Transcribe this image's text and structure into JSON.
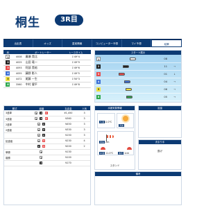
{
  "header": {
    "title": "桐生",
    "race_badge": "3R目"
  },
  "tabs": [
    {
      "label": "出走表"
    },
    {
      "label": "オッズ"
    },
    {
      "label": "直前情報"
    },
    {
      "label": "コンピューター予想"
    },
    {
      "label": "マイ予想"
    },
    {
      "label": "結果"
    }
  ],
  "racers": {
    "headers": [
      "枠",
      "",
      "ボートレーサー",
      "",
      "レースタイム"
    ],
    "rows": [
      {
        "lane": "1",
        "no": "4008",
        "name": "廣瀬 貴比",
        "time": "1'49\"4"
      },
      {
        "lane": "2",
        "no": "4025",
        "name": "山田 竜一",
        "time": "1'49\"9"
      },
      {
        "lane": "3",
        "no": "4093",
        "name": "阿部 貴裕",
        "time": "1'49\"6"
      },
      {
        "lane": "4",
        "no": "4055",
        "name": "藤野 影人",
        "time": "1'49\"5"
      },
      {
        "lane": "5",
        "no": "4472",
        "name": "尾藤 一生",
        "time": "1'50\"3"
      },
      {
        "lane": "6",
        "no": "3560",
        "name": "中村 健平",
        "time": "1'49\"8"
      }
    ]
  },
  "start": {
    "title": "スタート展示",
    "rows": [
      {
        "lane": "1",
        "val": "08",
        "deco": ""
      },
      {
        "lane": "2",
        "val": "11",
        "deco": "→"
      },
      {
        "lane": "3",
        "val": "01",
        "deco": "↓"
      },
      {
        "lane": "4",
        "val": "04",
        "deco": "→"
      },
      {
        "lane": "5",
        "val": "06",
        "deco": "→"
      },
      {
        "lane": "6",
        "val": "05",
        "deco": "→"
      }
    ]
  },
  "odds": {
    "headers": [
      "勝式",
      "組番",
      "払戻金",
      "人気"
    ],
    "rows": [
      {
        "kind": "3連単",
        "combo": [
          "1",
          "2",
          "3"
        ],
        "pay": "¥1,450",
        "pop": "3"
      },
      {
        "kind": "3連複",
        "combo": [
          "1",
          "2",
          "3"
        ],
        "pay": "¥360",
        "pop": "3"
      },
      {
        "kind": "2連単",
        "combo": [
          "1",
          "2"
        ],
        "pay": "¥450",
        "pop": "3"
      },
      {
        "kind": "2連複",
        "combo": [
          "1",
          "2"
        ],
        "pay": "¥330",
        "pop": "3"
      },
      {
        "kind": "",
        "combo": [
          "1",
          "2"
        ],
        "pay": "¥150",
        "pop": "3"
      },
      {
        "kind": "拡連複",
        "combo": [
          "1",
          "3"
        ],
        "pay": "¥230",
        "pop": "4"
      },
      {
        "kind": "",
        "combo": [
          "2",
          "3"
        ],
        "pay": "¥200",
        "pop": "2"
      },
      {
        "kind": "単勝",
        "combo": [
          "1"
        ],
        "pay": "¥130",
        "pop": ""
      },
      {
        "kind": "複勝",
        "combo": [
          "1"
        ],
        "pay": "¥100",
        "pop": ""
      },
      {
        "kind": "",
        "combo": [
          "2"
        ],
        "pay": "¥170",
        "pop": ""
      }
    ]
  },
  "weather": {
    "title": "水面気象情報",
    "temp_label": "気温",
    "temp": "11.0℃",
    "weather_label": "天候",
    "wind_label": "風速",
    "wind": "2m",
    "water_label": "水温",
    "water": "11.0℃",
    "wave_label": "波高",
    "wave": "1cm",
    "footer": "スタンド"
  },
  "side": {
    "top_label": "返還",
    "mid_label": "決まり手",
    "mid_value": "逃げ",
    "bottom_label": "備考"
  }
}
